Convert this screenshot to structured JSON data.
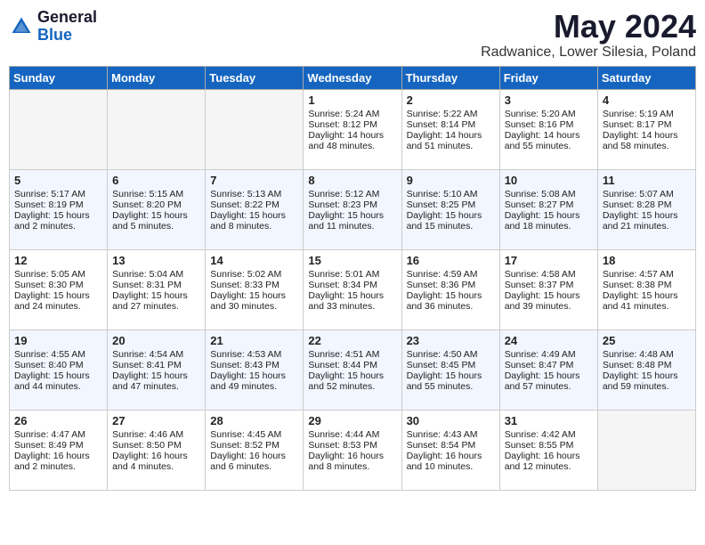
{
  "header": {
    "logo_general": "General",
    "logo_blue": "Blue",
    "month_title": "May 2024",
    "location": "Radwanice, Lower Silesia, Poland"
  },
  "days_of_week": [
    "Sunday",
    "Monday",
    "Tuesday",
    "Wednesday",
    "Thursday",
    "Friday",
    "Saturday"
  ],
  "weeks": [
    [
      {
        "day": "",
        "info": ""
      },
      {
        "day": "",
        "info": ""
      },
      {
        "day": "",
        "info": ""
      },
      {
        "day": "1",
        "sunrise": "Sunrise: 5:24 AM",
        "sunset": "Sunset: 8:12 PM",
        "daylight": "Daylight: 14 hours and 48 minutes."
      },
      {
        "day": "2",
        "sunrise": "Sunrise: 5:22 AM",
        "sunset": "Sunset: 8:14 PM",
        "daylight": "Daylight: 14 hours and 51 minutes."
      },
      {
        "day": "3",
        "sunrise": "Sunrise: 5:20 AM",
        "sunset": "Sunset: 8:16 PM",
        "daylight": "Daylight: 14 hours and 55 minutes."
      },
      {
        "day": "4",
        "sunrise": "Sunrise: 5:19 AM",
        "sunset": "Sunset: 8:17 PM",
        "daylight": "Daylight: 14 hours and 58 minutes."
      }
    ],
    [
      {
        "day": "5",
        "sunrise": "Sunrise: 5:17 AM",
        "sunset": "Sunset: 8:19 PM",
        "daylight": "Daylight: 15 hours and 2 minutes."
      },
      {
        "day": "6",
        "sunrise": "Sunrise: 5:15 AM",
        "sunset": "Sunset: 8:20 PM",
        "daylight": "Daylight: 15 hours and 5 minutes."
      },
      {
        "day": "7",
        "sunrise": "Sunrise: 5:13 AM",
        "sunset": "Sunset: 8:22 PM",
        "daylight": "Daylight: 15 hours and 8 minutes."
      },
      {
        "day": "8",
        "sunrise": "Sunrise: 5:12 AM",
        "sunset": "Sunset: 8:23 PM",
        "daylight": "Daylight: 15 hours and 11 minutes."
      },
      {
        "day": "9",
        "sunrise": "Sunrise: 5:10 AM",
        "sunset": "Sunset: 8:25 PM",
        "daylight": "Daylight: 15 hours and 15 minutes."
      },
      {
        "day": "10",
        "sunrise": "Sunrise: 5:08 AM",
        "sunset": "Sunset: 8:27 PM",
        "daylight": "Daylight: 15 hours and 18 minutes."
      },
      {
        "day": "11",
        "sunrise": "Sunrise: 5:07 AM",
        "sunset": "Sunset: 8:28 PM",
        "daylight": "Daylight: 15 hours and 21 minutes."
      }
    ],
    [
      {
        "day": "12",
        "sunrise": "Sunrise: 5:05 AM",
        "sunset": "Sunset: 8:30 PM",
        "daylight": "Daylight: 15 hours and 24 minutes."
      },
      {
        "day": "13",
        "sunrise": "Sunrise: 5:04 AM",
        "sunset": "Sunset: 8:31 PM",
        "daylight": "Daylight: 15 hours and 27 minutes."
      },
      {
        "day": "14",
        "sunrise": "Sunrise: 5:02 AM",
        "sunset": "Sunset: 8:33 PM",
        "daylight": "Daylight: 15 hours and 30 minutes."
      },
      {
        "day": "15",
        "sunrise": "Sunrise: 5:01 AM",
        "sunset": "Sunset: 8:34 PM",
        "daylight": "Daylight: 15 hours and 33 minutes."
      },
      {
        "day": "16",
        "sunrise": "Sunrise: 4:59 AM",
        "sunset": "Sunset: 8:36 PM",
        "daylight": "Daylight: 15 hours and 36 minutes."
      },
      {
        "day": "17",
        "sunrise": "Sunrise: 4:58 AM",
        "sunset": "Sunset: 8:37 PM",
        "daylight": "Daylight: 15 hours and 39 minutes."
      },
      {
        "day": "18",
        "sunrise": "Sunrise: 4:57 AM",
        "sunset": "Sunset: 8:38 PM",
        "daylight": "Daylight: 15 hours and 41 minutes."
      }
    ],
    [
      {
        "day": "19",
        "sunrise": "Sunrise: 4:55 AM",
        "sunset": "Sunset: 8:40 PM",
        "daylight": "Daylight: 15 hours and 44 minutes."
      },
      {
        "day": "20",
        "sunrise": "Sunrise: 4:54 AM",
        "sunset": "Sunset: 8:41 PM",
        "daylight": "Daylight: 15 hours and 47 minutes."
      },
      {
        "day": "21",
        "sunrise": "Sunrise: 4:53 AM",
        "sunset": "Sunset: 8:43 PM",
        "daylight": "Daylight: 15 hours and 49 minutes."
      },
      {
        "day": "22",
        "sunrise": "Sunrise: 4:51 AM",
        "sunset": "Sunset: 8:44 PM",
        "daylight": "Daylight: 15 hours and 52 minutes."
      },
      {
        "day": "23",
        "sunrise": "Sunrise: 4:50 AM",
        "sunset": "Sunset: 8:45 PM",
        "daylight": "Daylight: 15 hours and 55 minutes."
      },
      {
        "day": "24",
        "sunrise": "Sunrise: 4:49 AM",
        "sunset": "Sunset: 8:47 PM",
        "daylight": "Daylight: 15 hours and 57 minutes."
      },
      {
        "day": "25",
        "sunrise": "Sunrise: 4:48 AM",
        "sunset": "Sunset: 8:48 PM",
        "daylight": "Daylight: 15 hours and 59 minutes."
      }
    ],
    [
      {
        "day": "26",
        "sunrise": "Sunrise: 4:47 AM",
        "sunset": "Sunset: 8:49 PM",
        "daylight": "Daylight: 16 hours and 2 minutes."
      },
      {
        "day": "27",
        "sunrise": "Sunrise: 4:46 AM",
        "sunset": "Sunset: 8:50 PM",
        "daylight": "Daylight: 16 hours and 4 minutes."
      },
      {
        "day": "28",
        "sunrise": "Sunrise: 4:45 AM",
        "sunset": "Sunset: 8:52 PM",
        "daylight": "Daylight: 16 hours and 6 minutes."
      },
      {
        "day": "29",
        "sunrise": "Sunrise: 4:44 AM",
        "sunset": "Sunset: 8:53 PM",
        "daylight": "Daylight: 16 hours and 8 minutes."
      },
      {
        "day": "30",
        "sunrise": "Sunrise: 4:43 AM",
        "sunset": "Sunset: 8:54 PM",
        "daylight": "Daylight: 16 hours and 10 minutes."
      },
      {
        "day": "31",
        "sunrise": "Sunrise: 4:42 AM",
        "sunset": "Sunset: 8:55 PM",
        "daylight": "Daylight: 16 hours and 12 minutes."
      },
      {
        "day": "",
        "info": ""
      }
    ]
  ]
}
